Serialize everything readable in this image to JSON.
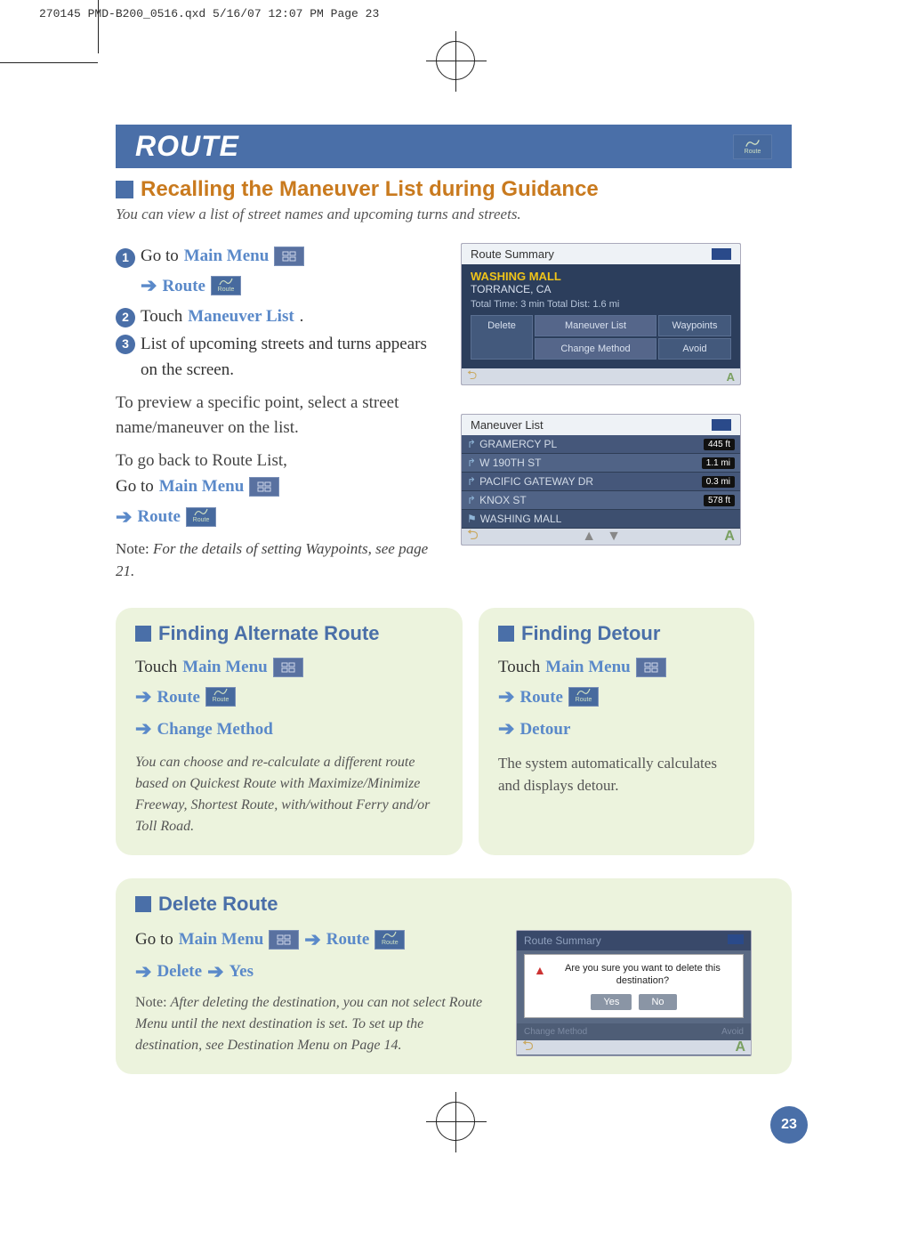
{
  "crop_header": "270145 PMD-B200_0516.qxd  5/16/07  12:07 PM  Page 23",
  "title": "ROUTE",
  "route_badge_label": "Route",
  "section": {
    "heading": "Recalling the Maneuver List during Guidance",
    "intro": "You can view a list of street names and upcoming turns and streets."
  },
  "steps": {
    "s1_pre": "Go to ",
    "main_menu": "Main Menu",
    "route": "Route",
    "s2_pre": "Touch ",
    "maneuver_list": "Maneuver List",
    "s3": "List of upcoming streets and turns appears on the screen."
  },
  "preview": "To preview a specific point, select a street name/maneuver on the list.",
  "goback": {
    "line1": "To go back to Route List,",
    "line2_pre": "Go to ",
    "note_label": "Note: ",
    "note_text": "For the details of setting Waypoints, see page 21."
  },
  "shot1": {
    "title": "Route Summary",
    "dest": "WASHING MALL",
    "city": "TORRANCE, CA",
    "meta": "Total Time: 3 min  Total Dist: 1.6 mi",
    "buttons": {
      "delete": "Delete",
      "mlist": "Maneuver List",
      "way": "Waypoints",
      "change": "Change Method",
      "avoid": "Avoid"
    }
  },
  "shot2": {
    "title": "Maneuver List",
    "rows": [
      {
        "name": "GRAMERCY PL",
        "dist": "445 ft"
      },
      {
        "name": "W 190TH ST",
        "dist": "1.1 mi"
      },
      {
        "name": "PACIFIC GATEWAY DR",
        "dist": "0.3 mi"
      },
      {
        "name": "KNOX ST",
        "dist": "578 ft"
      },
      {
        "name": "WASHING MALL",
        "dist": ""
      }
    ]
  },
  "alt": {
    "title": "Finding Alternate Route",
    "touch": "Touch ",
    "change_method": "Change Method",
    "desc": "You can choose and re-calculate a different route based on Quickest Route with Maximize/Minimize Freeway, Shortest Route, with/without Ferry and/or Toll Road."
  },
  "detour": {
    "title": "Finding Detour",
    "touch": "Touch ",
    "detour_label": "Detour",
    "desc": "The system automatically calculates and displays detour."
  },
  "delete": {
    "title": "Delete Route",
    "goto": "Go to ",
    "delete_label": "Delete",
    "yes_label": "Yes",
    "note_label": "Note: ",
    "note_text": "After deleting the destination, you can not select Route Menu until the next destination is set. To set up the destination, see Destination Menu on Page 14.",
    "dialog": {
      "hdr": "Route Summary",
      "msg": "Are you sure you want to delete this destination?",
      "yes": "Yes",
      "no": "No",
      "b1": "Change Method",
      "b2": "Avoid"
    }
  },
  "page_number": "23"
}
